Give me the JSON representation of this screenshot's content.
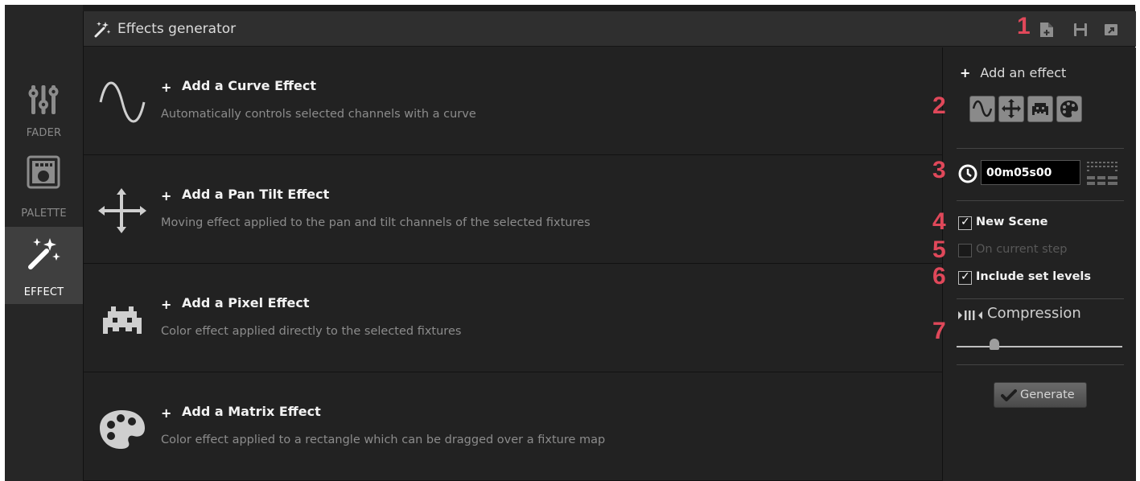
{
  "sidebar": {
    "items": [
      {
        "label": "FADER",
        "icon": "fader-icon"
      },
      {
        "label": "PALETTE",
        "icon": "palette-icon"
      },
      {
        "label": "EFFECT",
        "icon": "magic-wand-icon",
        "active": true
      }
    ]
  },
  "header": {
    "title": "Effects generator",
    "icons": [
      "magic-wand-icon",
      "file-new-icon",
      "save-icon",
      "export-icon"
    ]
  },
  "effects": [
    {
      "icon": "curve-icon",
      "name": "Add a Curve Effect",
      "description": "Automatically controls selected channels with a curve"
    },
    {
      "icon": "pan-tilt-icon",
      "name": "Add a Pan Tilt Effect",
      "description": "Moving effect applied to the pan and tilt channels of the selected fixtures"
    },
    {
      "icon": "pixel-invader-icon",
      "name": "Add a Pixel Effect",
      "description": "Color effect applied directly to the selected fixtures"
    },
    {
      "icon": "matrix-palette-icon",
      "name": "Add a Matrix Effect",
      "description": "Color effect applied to a rectangle which can be dragged over a fixture map"
    }
  ],
  "options": {
    "add_effect_label": "Add an effect",
    "type_buttons": [
      "curve-icon",
      "pan-tilt-icon",
      "pixel-invader-icon",
      "matrix-palette-icon"
    ],
    "duration": "00m05s00",
    "checkboxes": [
      {
        "label": "New Scene",
        "checked": true,
        "enabled": true
      },
      {
        "label": "On current step",
        "checked": false,
        "enabled": false
      },
      {
        "label": "Include set levels",
        "checked": true,
        "enabled": true
      }
    ],
    "compression_label": "Compression",
    "compression_value": 0.23,
    "generate_label": "Generate"
  },
  "callouts": [
    "1",
    "2",
    "3",
    "4",
    "5",
    "6",
    "7"
  ],
  "colors": {
    "callout": "#e0485a",
    "background": "#1c1c1c",
    "active_tab": "#3f3f3f"
  }
}
